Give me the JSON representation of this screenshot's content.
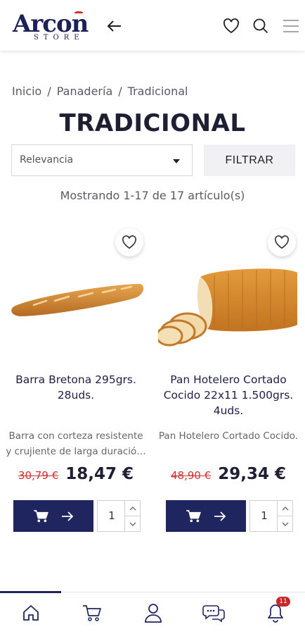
{
  "header": {
    "logo_main": "Arcon",
    "logo_sub": "STORE"
  },
  "breadcrumb": {
    "items": [
      "Inicio",
      "Panadería",
      "Tradicional"
    ],
    "separator": "/"
  },
  "page": {
    "title": "TRADICIONAL",
    "result_count": "Mostrando 1-17 de 17 artículo(s)"
  },
  "sort": {
    "selected": "Relevancia"
  },
  "filter": {
    "label": "FILTRAR"
  },
  "products": [
    {
      "name": "Barra Bretona 295grs. 28uds.",
      "description": "Barra con corteza resistente y crujiente de larga duració…",
      "old_price": "30,79 €",
      "price": "18,47 €",
      "quantity": "1"
    },
    {
      "name": "Pan Hotelero Cortado Cocido 22x11 1.500grs. 4uds.",
      "description": "Pan Hotelero Cortado Cocido.",
      "old_price": "48,90 €",
      "price": "29,34 €",
      "quantity": "1"
    }
  ],
  "bottom_nav": {
    "notification_count": "11"
  },
  "colors": {
    "brand_navy": "#1f255e",
    "sale_red": "#d32f2f",
    "badge_red": "#c62828"
  },
  "icons": [
    "back-arrow-icon",
    "heart-icon",
    "search-icon",
    "menu-icon",
    "cart-icon",
    "arrow-right-icon",
    "chevron-up-icon",
    "chevron-down-icon",
    "home-icon",
    "user-icon",
    "chat-icon",
    "bell-icon"
  ]
}
